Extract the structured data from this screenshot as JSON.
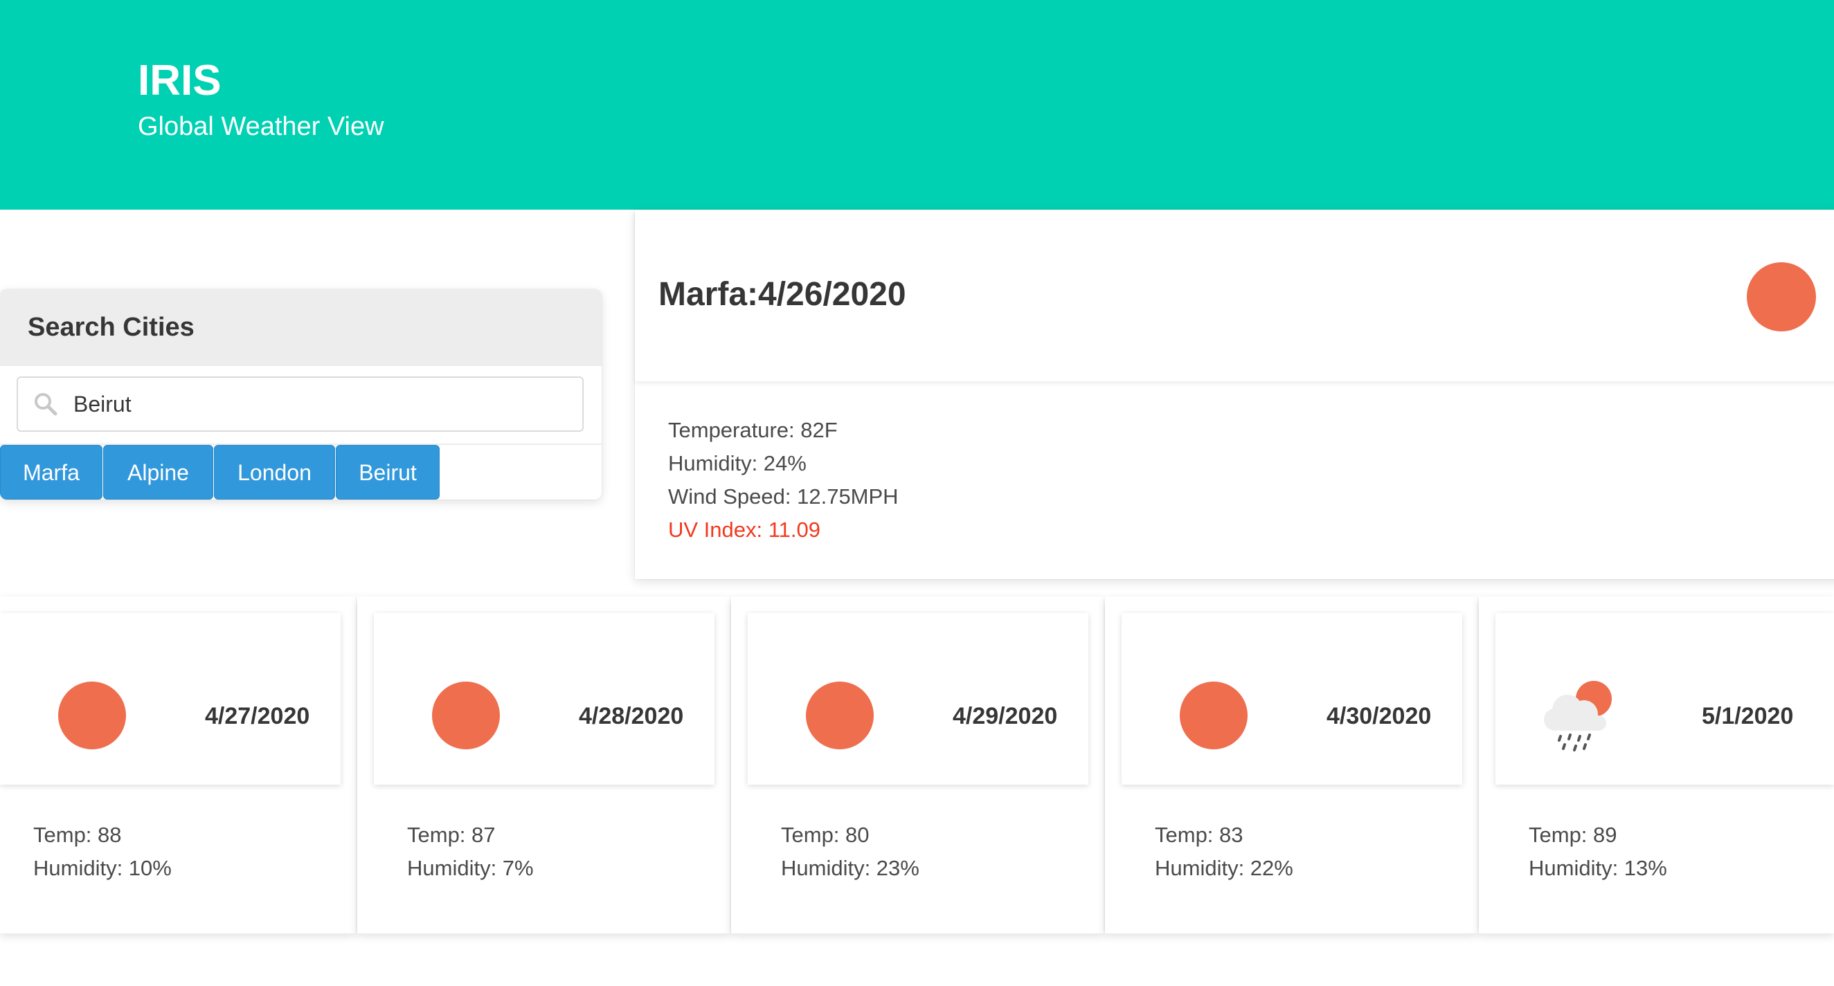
{
  "header": {
    "title": "IRIS",
    "subtitle": "Global Weather View"
  },
  "search": {
    "heading": "Search Cities",
    "value": "Beirut",
    "cities": [
      "Marfa",
      "Alpine",
      "London",
      "Beirut"
    ]
  },
  "current": {
    "title": "Marfa:4/26/2020",
    "icon": "sun-icon",
    "temperature": "Temperature: 82F",
    "humidity": "Humidity: 24%",
    "wind": "Wind Speed: 12.75MPH",
    "uv": "UV Index: 11.09"
  },
  "colors": {
    "hero": "#00d1b2",
    "button": "#3298dc",
    "sun": "#ee6e4e",
    "uv_alert": "#f1391f"
  },
  "forecast": [
    {
      "date": "4/27/2020",
      "icon": "sun-icon",
      "temp": "Temp: 88",
      "humidity": "Humidity: 10%"
    },
    {
      "date": "4/28/2020",
      "icon": "sun-icon",
      "temp": "Temp: 87",
      "humidity": "Humidity: 7%"
    },
    {
      "date": "4/29/2020",
      "icon": "sun-icon",
      "temp": "Temp: 80",
      "humidity": "Humidity: 23%"
    },
    {
      "date": "4/30/2020",
      "icon": "sun-icon",
      "temp": "Temp: 83",
      "humidity": "Humidity: 22%"
    },
    {
      "date": "5/1/2020",
      "icon": "rain-cloud-sun-icon",
      "temp": "Temp: 89",
      "humidity": "Humidity: 13%"
    }
  ]
}
